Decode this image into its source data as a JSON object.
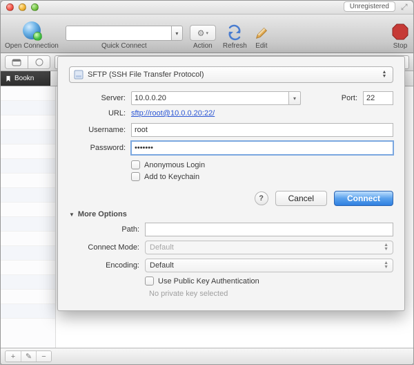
{
  "window": {
    "registration_badge": "Unregistered"
  },
  "toolbar": {
    "open_connection": "Open Connection",
    "quick_connect": "Quick Connect",
    "action": "Action",
    "refresh": "Refresh",
    "edit": "Edit",
    "stop": "Stop"
  },
  "tabs": {
    "bookmarks": "Bookn"
  },
  "sheet": {
    "protocol": "SFTP (SSH File Transfer Protocol)",
    "server_label": "Server:",
    "server_value": "10.0.0.20",
    "port_label": "Port:",
    "port_value": "22",
    "url_label": "URL:",
    "url_value": "sftp://root@10.0.0.20:22/",
    "username_label": "Username:",
    "username_value": "root",
    "password_label": "Password:",
    "password_masked": "•••••••",
    "anonymous": "Anonymous Login",
    "keychain": "Add to Keychain",
    "cancel": "Cancel",
    "connect": "Connect",
    "more": "More Options",
    "path_label": "Path:",
    "path_value": "",
    "cmode_label": "Connect Mode:",
    "cmode_value": "Default",
    "encoding_label": "Encoding:",
    "encoding_value": "Default",
    "pubkey": "Use Public Key Authentication",
    "nopk": "No private key selected"
  },
  "bottombar": {}
}
